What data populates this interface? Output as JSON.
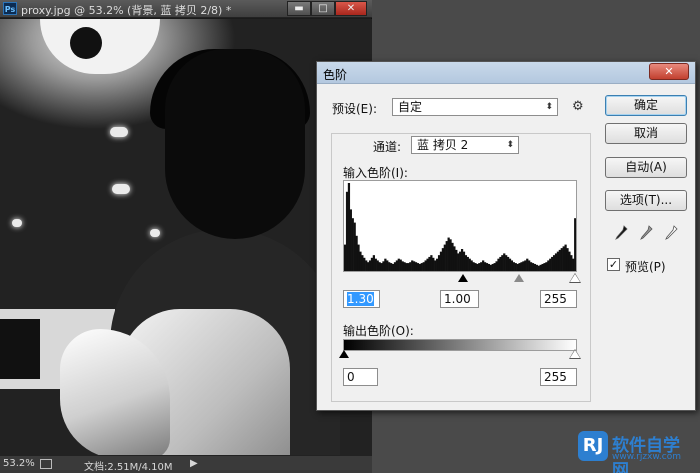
{
  "document": {
    "ps_badge": "Ps",
    "title": "proxy.jpg @ 53.2% (背景, 蓝 拷贝 2/8) *",
    "controls": {
      "minimize": "▬",
      "maximize": "□",
      "close": "✕"
    },
    "status": {
      "zoom": "53.2%",
      "doc_info": "文档:2.51M/4.10M",
      "arrow": "▶"
    }
  },
  "levels_dialog": {
    "title": "色阶",
    "close_symbol": "✕",
    "preset_label": "预设(E):",
    "preset_value": "自定",
    "channel_label": "通道:",
    "channel_value": "蓝 拷贝 2",
    "input_levels_label": "输入色阶(I):",
    "input_values": {
      "black": "1.30",
      "gamma": "1.00",
      "white": "255"
    },
    "output_levels_label": "输出色阶(O):",
    "output_values": {
      "black": "0",
      "white": "255"
    },
    "buttons": {
      "ok": "确定",
      "cancel": "取消",
      "auto": "自动(A)",
      "options": "选项(T)..."
    },
    "preview_label": "预览(P)",
    "preview_checked": true,
    "gear_icon": "⚙",
    "histogram": [
      30,
      90,
      100,
      70,
      60,
      55,
      40,
      30,
      22,
      18,
      15,
      12,
      10,
      12,
      15,
      18,
      14,
      12,
      10,
      9,
      11,
      14,
      12,
      10,
      9,
      8,
      10,
      12,
      14,
      13,
      11,
      10,
      9,
      9,
      10,
      12,
      11,
      10,
      9,
      8,
      9,
      10,
      12,
      14,
      16,
      18,
      15,
      12,
      14,
      18,
      22,
      26,
      30,
      34,
      38,
      36,
      32,
      28,
      24,
      20,
      22,
      25,
      22,
      18,
      16,
      14,
      12,
      10,
      9,
      8,
      9,
      10,
      12,
      10,
      9,
      8,
      7,
      8,
      9,
      11,
      14,
      16,
      18,
      20,
      18,
      16,
      14,
      12,
      10,
      9,
      8,
      9,
      10,
      11,
      12,
      14,
      12,
      10,
      9,
      8,
      7,
      6,
      7,
      8,
      9,
      10,
      12,
      14,
      16,
      18,
      20,
      22,
      24,
      26,
      28,
      30,
      26,
      22,
      18,
      14,
      60
    ]
  },
  "watermark": {
    "logo": "RJ",
    "name": "软件自学网",
    "url": "www.rjzxw.com"
  }
}
